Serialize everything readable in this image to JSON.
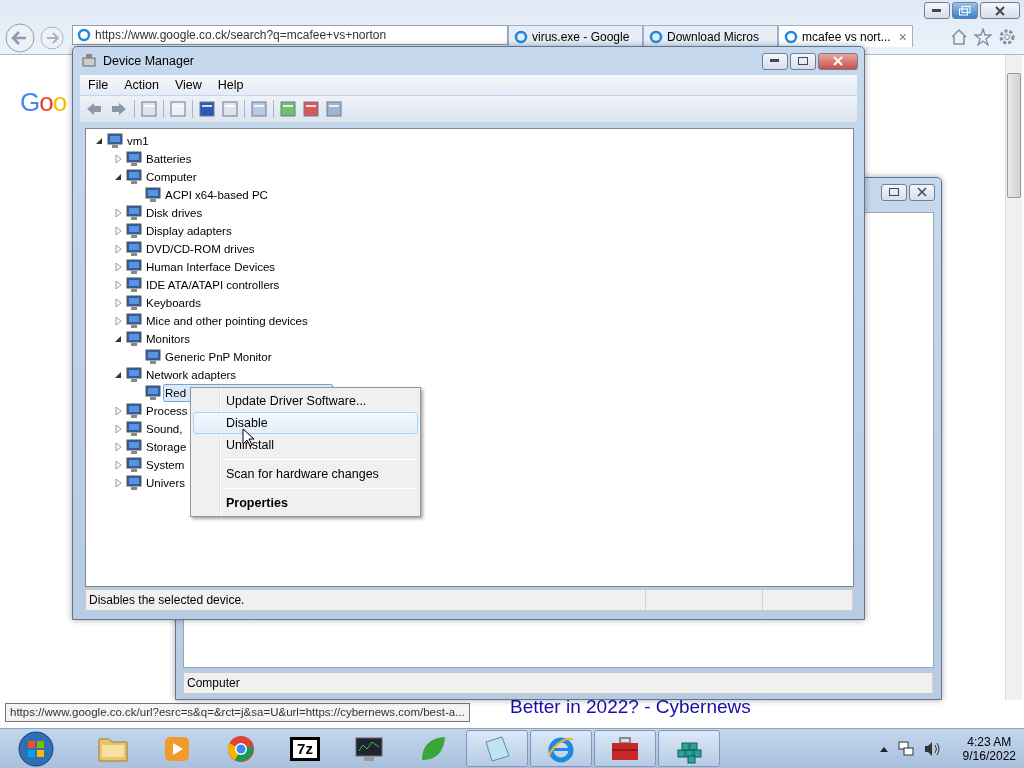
{
  "browser": {
    "address": "https://www.google.co.ck/search?q=mcafee+vs+norton",
    "tabs": [
      {
        "label": "virus.exe - Google",
        "selected": false
      },
      {
        "label": "Download Micros",
        "selected": false
      },
      {
        "label": "mcafee vs nort...",
        "selected": true,
        "close": "×"
      }
    ],
    "logo": "Goo",
    "link": "Better in 2022? - Cybernews",
    "status_url": "https://www.google.co.ck/url?esrc=s&q=&rct=j&sa=U&url=https://cybernews.com/best-a..."
  },
  "background_window": {
    "status": "Computer"
  },
  "device_manager": {
    "title": "Device Manager",
    "menu": [
      "File",
      "Action",
      "View",
      "Help"
    ],
    "tree": {
      "label": "vm1",
      "expanded": true,
      "selected": false,
      "children": [
        {
          "label": "Batteries",
          "expanded": false,
          "selected": false
        },
        {
          "label": "Computer",
          "expanded": true,
          "selected": false,
          "children": [
            {
              "label": "ACPI x64-based PC",
              "selected": false
            }
          ]
        },
        {
          "label": "Disk drives",
          "expanded": false,
          "selected": false
        },
        {
          "label": "Display adapters",
          "expanded": false,
          "selected": false
        },
        {
          "label": "DVD/CD-ROM drives",
          "expanded": false,
          "selected": false
        },
        {
          "label": "Human Interface Devices",
          "expanded": false,
          "selected": false
        },
        {
          "label": "IDE ATA/ATAPI controllers",
          "expanded": false,
          "selected": false
        },
        {
          "label": "Keyboards",
          "expanded": false,
          "selected": false
        },
        {
          "label": "Mice and other pointing devices",
          "expanded": false,
          "selected": false
        },
        {
          "label": "Monitors",
          "expanded": true,
          "selected": false,
          "children": [
            {
              "label": "Generic PnP Monitor",
              "selected": false
            }
          ]
        },
        {
          "label": "Network adapters",
          "expanded": true,
          "selected": false,
          "children": [
            {
              "label": "Red",
              "selected": true
            }
          ]
        },
        {
          "label": "Process",
          "expanded": false,
          "selected": false
        },
        {
          "label": "Sound,",
          "expanded": false,
          "selected": false
        },
        {
          "label": "Storage",
          "expanded": false,
          "selected": false
        },
        {
          "label": "System",
          "expanded": false,
          "selected": false
        },
        {
          "label": "Univers",
          "expanded": false,
          "selected": false
        }
      ]
    },
    "status": "Disables the selected device."
  },
  "context_menu": {
    "items": [
      {
        "kind": "item",
        "label": "Update Driver Software...",
        "selected": false,
        "default": false
      },
      {
        "kind": "item",
        "label": "Disable",
        "selected": true,
        "default": false
      },
      {
        "kind": "item",
        "label": "Uninstall",
        "selected": false,
        "default": false
      },
      {
        "kind": "separator"
      },
      {
        "kind": "item",
        "label": "Scan for hardware changes",
        "selected": false,
        "default": false
      },
      {
        "kind": "separator"
      },
      {
        "kind": "item",
        "label": "Properties",
        "selected": false,
        "default": true
      }
    ]
  },
  "taskbar": {
    "apps": [
      {
        "kind": "folder",
        "running": false
      },
      {
        "kind": "media",
        "running": false
      },
      {
        "kind": "globe",
        "running": false
      },
      {
        "kind": "archive",
        "label": "7z",
        "running": false
      },
      {
        "kind": "monitor",
        "running": false
      },
      {
        "kind": "leaf",
        "running": false
      },
      {
        "kind": "notepad",
        "running": true
      },
      {
        "kind": "ie",
        "running": true
      },
      {
        "kind": "toolbox",
        "running": true
      },
      {
        "kind": "cubes",
        "running": true
      }
    ],
    "time": "4:23 AM",
    "date": "9/16/2022"
  }
}
